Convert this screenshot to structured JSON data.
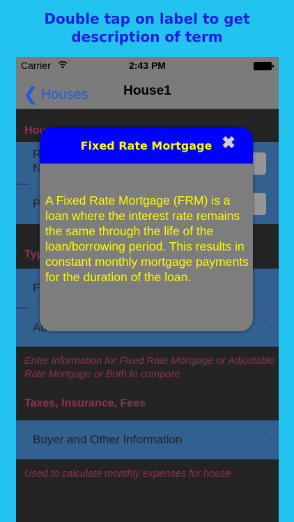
{
  "promo": {
    "line1": "Double tap on label to get",
    "line2": "description of term"
  },
  "status_bar": {
    "carrier": "Carrier",
    "time": "2:43 PM"
  },
  "nav": {
    "back_label": "Houses",
    "title": "House1"
  },
  "popup": {
    "title": "Fixed Rate Mortgage",
    "body": "A Fixed Rate Mortgage (FRM) is a loan where the interest rate remains the same through the life of the loan/borrowing period. This results in constant monthly mortgage payments for the duration of the loan."
  },
  "sections": {
    "house_section": {
      "header": "Hou",
      "rows": [
        {
          "label_top": "R",
          "label_bottom": "N"
        },
        {
          "label": "P"
        }
      ]
    },
    "type_section": {
      "header": "Typ",
      "rows": [
        {
          "label": "F"
        },
        {
          "label": "Ad"
        }
      ]
    },
    "type_footer": "Enter Information for Fixed Rate Mortgage or Adjustable Rate Mortgage or Both to compare",
    "taxes_section": {
      "header": "Taxes, Insurance, Fees",
      "rows": [
        {
          "label": "Buyer and Other Information"
        }
      ]
    },
    "taxes_footer": "Used to calculate monthly expenses for house"
  },
  "icons": {
    "back": "chevron-left-icon",
    "close": "close-x-icon",
    "wifi": "wifi-icon",
    "battery": "battery-icon",
    "disclosure": "chevron-right-icon"
  },
  "colors": {
    "background": "#22c3ee",
    "header_text": "#c2165d",
    "popup_header": "#0000fe",
    "popup_text": "#fffb00",
    "cell": "#1b6ec5"
  }
}
